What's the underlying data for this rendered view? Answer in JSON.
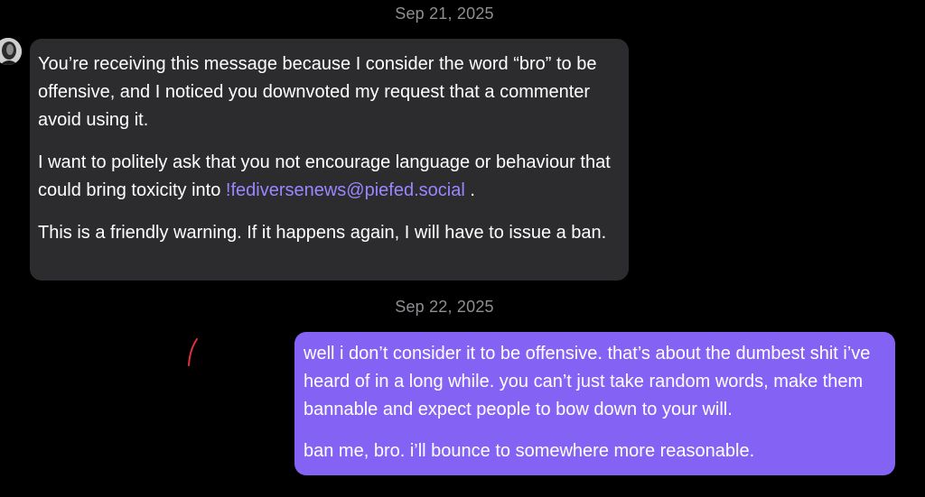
{
  "conversation": {
    "dates": [
      "Sep 21, 2025",
      "Sep 22, 2025"
    ],
    "incoming": {
      "p1": "You’re receiving this message because I consider the word “bro” to be offensive, and I noticed you downvoted my request that a commenter avoid using it.",
      "p2_before": "I want to politely ask that you not encourage language or behaviour that could bring toxicity into ",
      "p2_link": "!fediversenews@piefed.social",
      "p2_after": " .",
      "p3": "This is a friendly warning. If it happens again, I will have to issue a ban."
    },
    "outgoing": {
      "p1": "well i don’t consider it to be offensive. that’s about the dumbest shit i’ve heard of in a long while. you can’t just take random words, make them bannable and expect people to bow down to your will.",
      "p2": "ban me, bro. i’ll bounce to somewhere more reasonable."
    }
  },
  "colors": {
    "background": "#000000",
    "incoming_bubble": "#2c2c2e",
    "outgoing_bubble": "#8463f4",
    "link": "#9b86ff",
    "date_text": "#8e8e93",
    "scribble": "#e0303a"
  }
}
